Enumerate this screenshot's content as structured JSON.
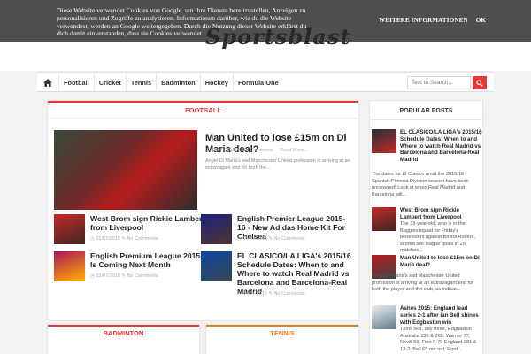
{
  "cookie_bar": {
    "text": "Diese Website verwendet Cookies von Google, um ihre Dienste bereitzustellen, Anzeigen zu personalisieren und Zugriffe zu analysieren. Informationen darüber, wie du die Website verwendest, werden an Google weitergegeben. Durch die Nutzung dieser Website erklärst du dich damit einverstanden, dass sie Cookies verwendet.",
    "more_info": "WEITERE INFORMATIONEN",
    "ok": "OK"
  },
  "site": {
    "logo": "Sportsblast"
  },
  "nav": {
    "home_icon": "home-icon",
    "items": [
      "Football",
      "Cricket",
      "Tennis",
      "Badminton",
      "Hockey",
      "Formula One"
    ],
    "search_placeholder": "Text to Search...",
    "search_icon": "search-icon"
  },
  "football": {
    "header": "FOOTBALL",
    "featured": {
      "title": "Man United to lose £15m on Di Maria deal?",
      "date": "31/07/2015",
      "comments": "No Comments",
      "read_more": "Read More...",
      "excerpt": "Angel Di Maria's sad Manchester United profession is arriving at an extravagant end for both the..."
    },
    "posts": [
      {
        "title": "West Brom sign Rickie Lambert from Liverpool",
        "date": "31/07/2015",
        "comments": "No Comments"
      },
      {
        "title": "English Premier League 2015-16 - New Adidas Home Kit For Chelsea",
        "date": "16/07/2015",
        "comments": "No Comments"
      },
      {
        "title": "English Premium League 2015 Is Coming Next Month",
        "date": "15/07/2015",
        "comments": "No Comments"
      },
      {
        "title": "EL CLASICO/LA LIGA's 2015/16 Schedule Dates: When to and Where to watch Real Madrid vs Barcelona and Barcelona-Real Madrid",
        "date": "14/07/2015",
        "comments": "No Comments"
      }
    ]
  },
  "bottom_sections": [
    {
      "header": "BADMINTON",
      "color": "#e53935"
    },
    {
      "header": "TENNIS",
      "color": "#e67e22"
    }
  ],
  "sidebar": {
    "header": "POPULAR POSTS",
    "posts": [
      {
        "title": "EL CLASICO/LA LIGA's 2015/16 Schedule Dates: When to and Where to watch Real Madrid vs Barcelona and Barcelona-Real Madrid",
        "excerpt": "The dates for El Clasico amid the 2015/16 Spanish Primera Division season have been uncovered! Look at when Real Madrid and Barcelona will..."
      },
      {
        "title": "West Brom sign Rickie Lambert from Liverpool",
        "excerpt": "The 33-year-old, who is in the Baggies squad for Friday's benevolent against Bristol Rovers, scored two league goals in 25 matches..."
      },
      {
        "title": "Man United to lose £15m on Di Maria deal?",
        "excerpt": "Angel Di Maria's sad Manchester United profession is arriving at an extravagant end for both the player and the club, as indicat..."
      },
      {
        "title": "Ashes 2015: England lead series 2-1 after Ian Bell shines with Edgbaston win",
        "excerpt": "Third Test, day three, Edgbaston : Australia 136 & 265: Warner 77, Nevill 59. Finn 6-79 England 281 & 12-2: Bell 65 not out, Root..."
      }
    ]
  },
  "colors": {
    "accent": "#e53935",
    "tennis": "#e67e22"
  }
}
